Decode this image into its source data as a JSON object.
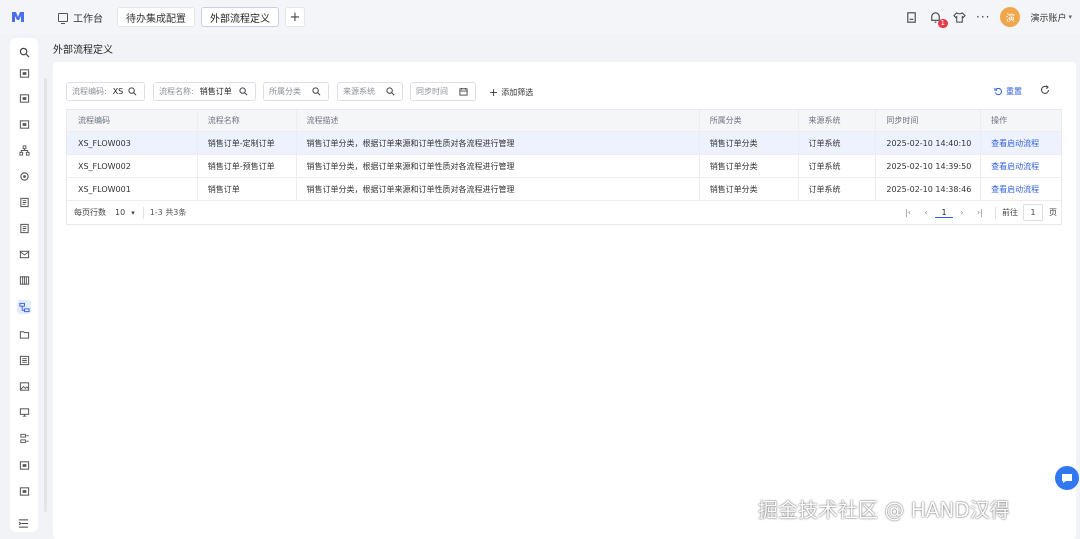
{
  "colors": {
    "accent": "#2f5fe0",
    "badge": "#e6394a",
    "avatar": "#f0a64a",
    "assistant": "#2f78f0"
  },
  "tabs": [
    {
      "label": "工作台",
      "icon": "monitor-icon"
    },
    {
      "label": "待办集成配置"
    },
    {
      "label": "外部流程定义",
      "active": true
    }
  ],
  "header": {
    "notification_count": "1",
    "more": "···",
    "avatar_text": "演",
    "user_name": "演示账户",
    "icons": [
      "doc-icon",
      "bell-icon",
      "shirt-icon",
      "more-icon"
    ]
  },
  "sidebar": {
    "icons": [
      "search-icon",
      "module-icon",
      "module-icon",
      "module-icon",
      "org-icon",
      "gear-icon",
      "form-icon",
      "form-icon",
      "mail-icon",
      "grid-icon",
      "flow-icon",
      "folder-icon",
      "list-icon",
      "image-icon",
      "device-icon",
      "list-icon",
      "module-icon",
      "module-icon"
    ],
    "collapse_icon": "collapse-icon"
  },
  "page": {
    "title": "外部流程定义"
  },
  "filters": [
    {
      "label": "流程编码:",
      "value": "XS",
      "icon": "search-icon"
    },
    {
      "label": "流程名称:",
      "value": "销售订单",
      "icon": "search-icon"
    },
    {
      "label": "所属分类",
      "value": "",
      "icon": "search-icon"
    },
    {
      "label": "来源系统",
      "value": "",
      "icon": "search-icon"
    },
    {
      "label": "同步时间",
      "value": "",
      "icon": "calendar-icon"
    }
  ],
  "toolbar": {
    "add_filter": "添加筛选",
    "reset": "重置"
  },
  "table": {
    "columns": [
      "流程编码",
      "流程名称",
      "流程描述",
      "所属分类",
      "来源系统",
      "同步时间",
      "操作"
    ],
    "rows": [
      {
        "code": "XS_FLOW003",
        "name": "销售订单-定制订单",
        "desc": "销售订单分类，根据订单来源和订单性质对各流程进行管理",
        "category": "销售订单分类",
        "source": "订单系统",
        "sync_time": "2025-02-10 14:40:10",
        "action": "查看启动流程"
      },
      {
        "code": "XS_FLOW002",
        "name": "销售订单-预售订单",
        "desc": "销售订单分类，根据订单来源和订单性质对各流程进行管理",
        "category": "销售订单分类",
        "source": "订单系统",
        "sync_time": "2025-02-10 14:39:50",
        "action": "查看启动流程"
      },
      {
        "code": "XS_FLOW001",
        "name": "销售订单",
        "desc": "销售订单分类，根据订单来源和订单性质对各流程进行管理",
        "category": "销售订单分类",
        "source": "订单系统",
        "sync_time": "2025-02-10 14:38:46",
        "action": "查看启动流程"
      }
    ]
  },
  "pagination": {
    "per_page_label": "每页行数",
    "per_page": "10",
    "range": "1-3 共3条",
    "current": "1",
    "goto_label": "前往",
    "goto_value": "1",
    "page_unit": "页"
  },
  "watermark": "掘金技术社区 @ HAND汉得"
}
